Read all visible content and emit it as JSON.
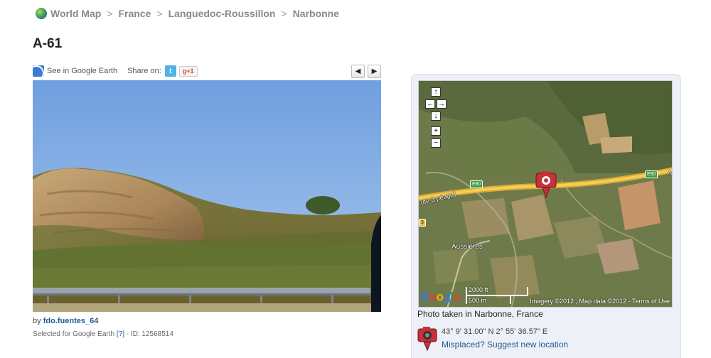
{
  "breadcrumb": {
    "items": [
      "World Map",
      "France",
      "Languedoc-Roussillon",
      "Narbonne"
    ],
    "separator": ">"
  },
  "page": {
    "title": "A-61"
  },
  "toolbar": {
    "google_earth_link": "See in Google Earth",
    "share_label": "Share on:",
    "twitter_icon_glyph": "t",
    "gplus_label": "g+1",
    "prev_glyph": "◀",
    "next_glyph": "▶"
  },
  "photo": {
    "byline_prefix": "by",
    "author": "fdo.fuentes_64",
    "selected_text": "Selected for Google Earth",
    "help_link": "[?]",
    "id_text": "- ID: 12568514"
  },
  "map": {
    "controls": {
      "up": "↑",
      "left": "←",
      "right": "→",
      "down": "↓",
      "zoom_in": "+",
      "zoom_out": "−"
    },
    "google_logo": "Google",
    "scale_ft": "2000 ft",
    "scale_m": "500 m",
    "copyright": "Imagery ©2012 , Map data ©2012 - Terms of Use",
    "labels": {
      "road_toll": "ute à péage)",
      "town": "Aussières",
      "e80_left": "E80",
      "e80_right": "E80",
      "route_num": "3",
      "edge_letter": "A"
    }
  },
  "location": {
    "taken_in": "Photo taken in Narbonne, France",
    "coordinates": "43° 9' 31.00\" N  2° 55' 36.57\" E",
    "misplaced_link": "Misplaced? Suggest new location"
  },
  "colors": {
    "link": "#1e5a96",
    "breadcrumb": "#8a8a8a",
    "panel_bg": "#edf0f6",
    "marker": "#c8303a"
  }
}
